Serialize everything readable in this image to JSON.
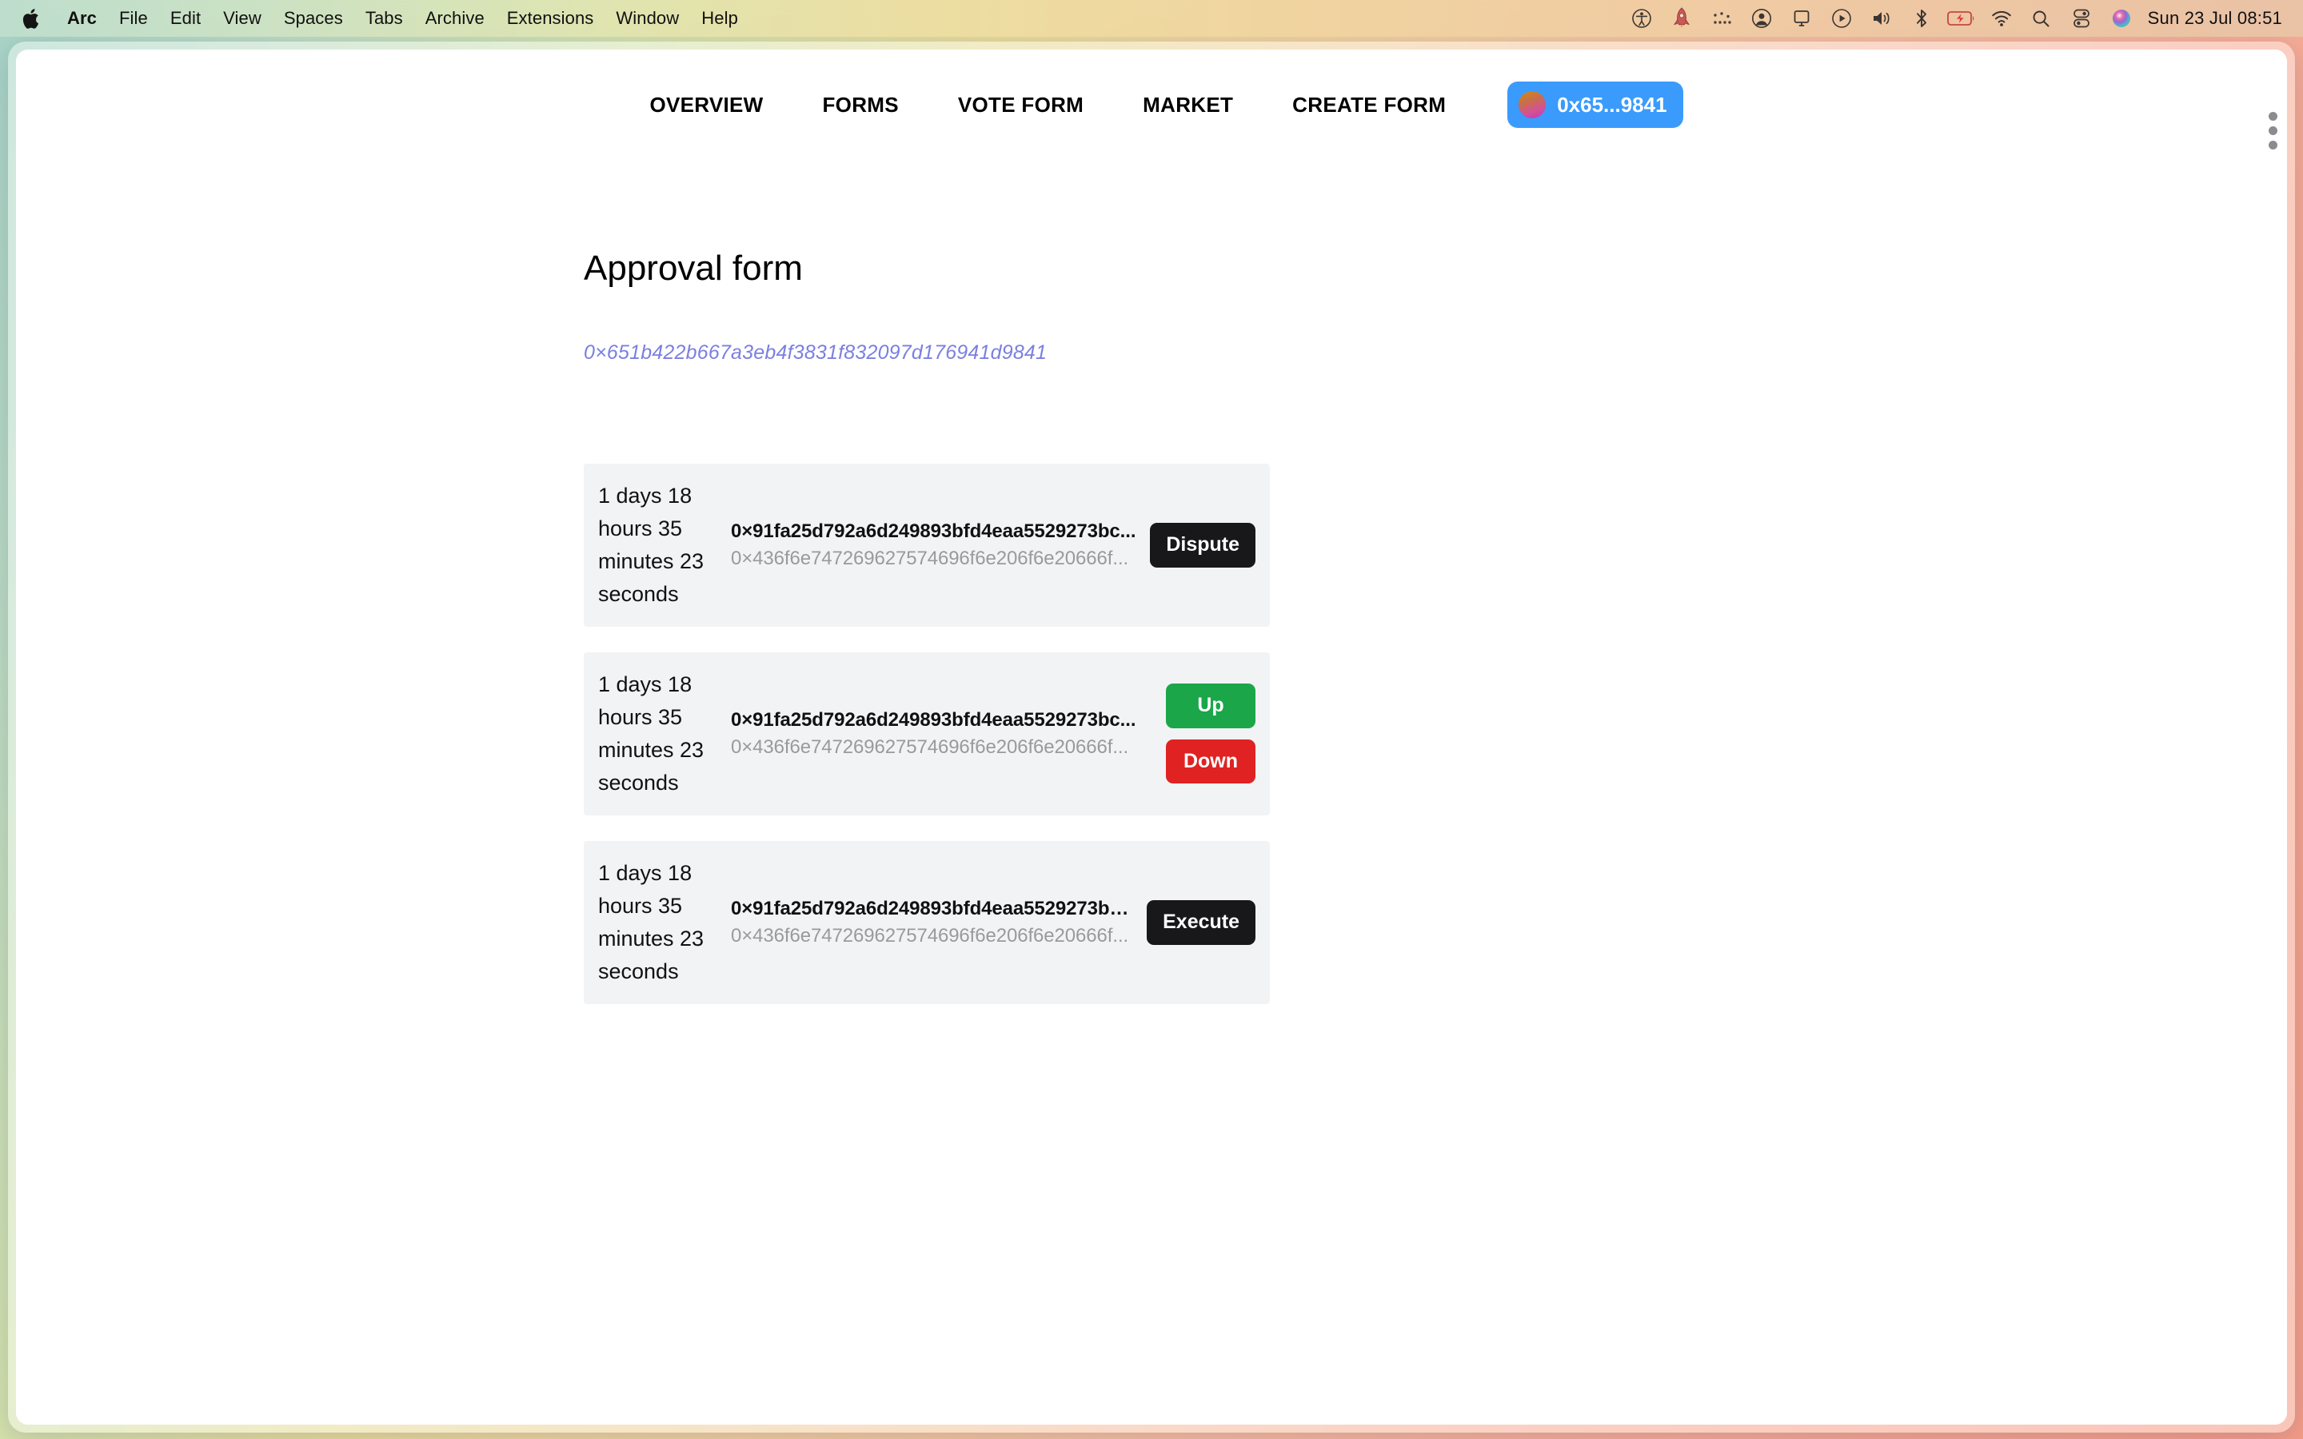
{
  "menubar": {
    "apple_icon": "apple-logo-icon",
    "items": [
      {
        "label": "Arc",
        "bold": true
      },
      {
        "label": "File",
        "bold": false
      },
      {
        "label": "Edit",
        "bold": false
      },
      {
        "label": "View",
        "bold": false
      },
      {
        "label": "Spaces",
        "bold": false
      },
      {
        "label": "Tabs",
        "bold": false
      },
      {
        "label": "Archive",
        "bold": false
      },
      {
        "label": "Extensions",
        "bold": false
      },
      {
        "label": "Window",
        "bold": false
      },
      {
        "label": "Help",
        "bold": false
      }
    ],
    "status_icons": [
      "accessibility-icon",
      "stats-rocket-icon",
      "dots-menu-icon",
      "user-account-icon",
      "display-icon",
      "play-circle-icon",
      "volume-icon",
      "bluetooth-icon",
      "battery-charging-icon",
      "wifi-icon",
      "search-icon",
      "control-center-icon",
      "siri-icon"
    ],
    "clock": "Sun 23 Jul  08:51"
  },
  "browser": {
    "sidebar_handle": "sidebar-resize-handle-icon"
  },
  "nav": {
    "links": [
      {
        "label": "Overview"
      },
      {
        "label": "Forms"
      },
      {
        "label": "Vote form"
      },
      {
        "label": "Market"
      },
      {
        "label": "Create form"
      }
    ],
    "wallet": {
      "label": "0x65...9841",
      "avatar": "wallet-avatar-icon",
      "color": "#3a9bfc"
    }
  },
  "page": {
    "title": "Approval form",
    "contract_address": "0×651b422b667a3eb4f3831f832097d176941d9841",
    "address_color": "#7b7fe0"
  },
  "cards": [
    {
      "timer": "1 days 18 hours 35 minutes 23 seconds",
      "hash_primary": "0×91fa25d792a6d249893bfd4eaa5529273bc...",
      "hash_secondary": "0×436f6e747269627574696f6e206f6e20666f...",
      "actions": [
        {
          "label": "Dispute",
          "style": "btn-dark",
          "color": "#18181b",
          "name": "dispute-button"
        }
      ]
    },
    {
      "timer": "1 days 18 hours 35 minutes 23 seconds",
      "hash_primary": "0×91fa25d792a6d249893bfd4eaa5529273bc...",
      "hash_secondary": "0×436f6e747269627574696f6e206f6e20666f...",
      "actions": [
        {
          "label": "Up",
          "style": "btn-green",
          "color": "#1ba64a",
          "name": "vote-up-button"
        },
        {
          "label": "Down",
          "style": "btn-red",
          "color": "#e02222",
          "name": "vote-down-button"
        }
      ]
    },
    {
      "timer": "1 days 18 hours 35 minutes 23 seconds",
      "hash_primary": "0×91fa25d792a6d249893bfd4eaa5529273bc...",
      "hash_secondary": "0×436f6e747269627574696f6e206f6e20666f...",
      "actions": [
        {
          "label": "Execute",
          "style": "btn-dark",
          "color": "#18181b",
          "name": "execute-button"
        }
      ]
    }
  ]
}
